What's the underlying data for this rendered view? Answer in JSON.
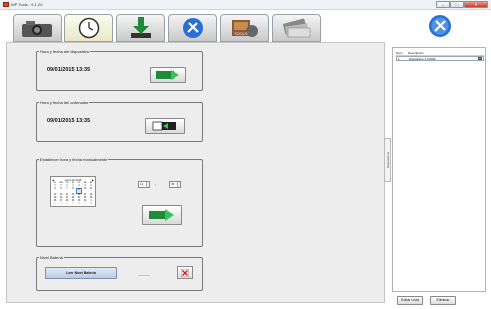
{
  "window": {
    "title": "WP Tools - 9.1.20",
    "min": "–",
    "max": "□",
    "close": "✕"
  },
  "toolbar": {
    "tabs": [
      {
        "icon": "camera-icon"
      },
      {
        "icon": "clock-icon"
      },
      {
        "icon": "download-icon"
      },
      {
        "icon": "tools-icon"
      },
      {
        "icon": "tools-photo-icon"
      },
      {
        "icon": "cards-icon"
      }
    ],
    "active_tab": 1,
    "help_icon": "tools-help-icon"
  },
  "device_time": {
    "group_label": "Hora y fecha del dispositivo",
    "value": "09/01/2015  13:35"
  },
  "computer_time": {
    "group_label": "Hora y fecha del ordenador",
    "value": "09/01/2015  13:35"
  },
  "manual_time": {
    "group_label": "Establecer hora y fecha manualmente",
    "calendar": {
      "prev": "◀",
      "month": "enero de 2015",
      "next": "▶",
      "weekdays": [
        "lu",
        "ma",
        "mi",
        "ju",
        "vi",
        "sá",
        "do"
      ],
      "days": [
        "29",
        "30",
        "31",
        "1",
        "2",
        "3",
        "4",
        "5",
        "6",
        "7",
        "8",
        "9",
        "10",
        "11",
        "12",
        "13",
        "14",
        "15",
        "16",
        "17",
        "18",
        "19",
        "20",
        "21",
        "22",
        "23",
        "24",
        "25",
        "26",
        "27",
        "28",
        "29",
        "30",
        "31",
        "1",
        "2",
        "3",
        "4",
        "5",
        "6",
        "7",
        "8"
      ],
      "selected": "9"
    },
    "hour": "13",
    "colon": ":",
    "minute": "35"
  },
  "battery": {
    "group_label": "Nivel Batería",
    "read_button": "Leer Nivel Batería",
    "value": "———"
  },
  "side_tab": {
    "label": "Dispositivos"
  },
  "device_list": {
    "headers": [
      "Num",
      "Descripción"
    ],
    "rows": [
      {
        "num": "1",
        "desc": "Dispositivo 1 COM2",
        "check": "☒"
      }
    ]
  },
  "bottom_buttons": {
    "edit": "Editar Lista",
    "delete": "Eliminar"
  },
  "colors": {
    "accent_green": "#1e8a3a",
    "arrow_green": "#37c25a",
    "help_blue": "#2a6fd1",
    "red_x": "#c82020"
  }
}
